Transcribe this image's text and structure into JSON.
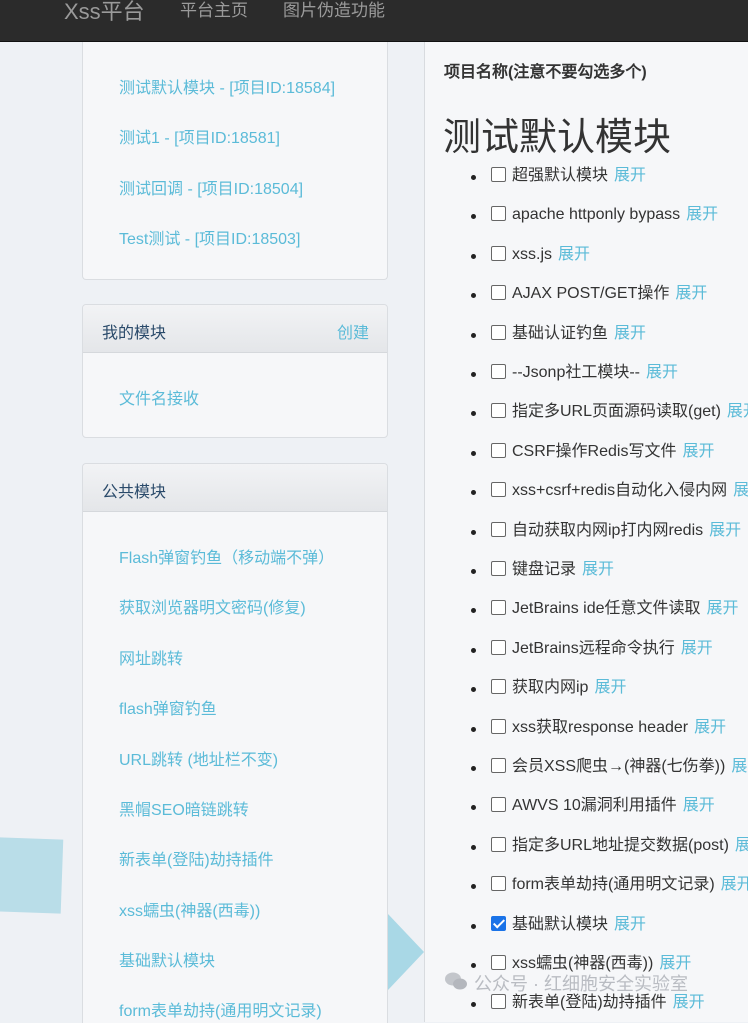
{
  "navbar": {
    "brand": "Xss平台",
    "links": [
      "平台主页",
      "图片伪造功能"
    ]
  },
  "projects": {
    "items": [
      "测试默认模块 - [项目ID:18584]",
      "测试1 - [项目ID:18581]",
      "测试回调 - [项目ID:18504]",
      "Test测试 - [项目ID:18503]"
    ]
  },
  "my_modules": {
    "title": "我的模块",
    "create": "创建",
    "items": [
      "文件名接收"
    ]
  },
  "public_modules": {
    "title": "公共模块",
    "items": [
      "Flash弹窗钓鱼（移动端不弹）",
      "获取浏览器明文密码(修复)",
      "网址跳转",
      "flash弹窗钓鱼",
      "URL跳转 (地址栏不变)",
      "黑帽SEO暗链跳转",
      "新表单(登陆)劫持插件",
      "xss蠕虫(神器(西毒))",
      "基础默认模块",
      "form表单劫持(通用明文记录)"
    ]
  },
  "project_form": {
    "label": "项目名称(注意不要勾选多个)",
    "heading": "测试默认模块",
    "expand_label": "展开",
    "modules": [
      {
        "name": "超强默认模块",
        "checked": false
      },
      {
        "name": "apache httponly bypass",
        "checked": false
      },
      {
        "name": "xss.js",
        "checked": false
      },
      {
        "name": "AJAX POST/GET操作",
        "checked": false
      },
      {
        "name": "基础认证钓鱼",
        "checked": false
      },
      {
        "name": "--Jsonp社工模块--",
        "checked": false
      },
      {
        "name": "指定多URL页面源码读取(get)",
        "checked": false
      },
      {
        "name": "CSRF操作Redis写文件",
        "checked": false
      },
      {
        "name": "xss+csrf+redis自动化入侵内网",
        "checked": false
      },
      {
        "name": "自动获取内网ip打内网redis",
        "checked": false
      },
      {
        "name": "键盘记录",
        "checked": false
      },
      {
        "name": "JetBrains ide任意文件读取",
        "checked": false
      },
      {
        "name": "JetBrains远程命令执行",
        "checked": false
      },
      {
        "name": "获取内网ip",
        "checked": false
      },
      {
        "name": "xss获取response header",
        "checked": false
      },
      {
        "name": "会员XSS爬虫→(神器(七伤拳))",
        "checked": false
      },
      {
        "name": "AWVS 10漏洞利用插件",
        "checked": false
      },
      {
        "name": "指定多URL地址提交数据(post)",
        "checked": false
      },
      {
        "name": "form表单劫持(通用明文记录)",
        "checked": false
      },
      {
        "name": "基础默认模块",
        "checked": true
      },
      {
        "name": "xss蠕虫(神器(西毒))",
        "checked": false
      },
      {
        "name": "新表单(登陆)劫持插件",
        "checked": false
      }
    ]
  },
  "watermark": "公众号 · 红细胞安全实验室",
  "colors": {
    "navbar_bg": "#2b2b2b",
    "link": "#5bbbd8",
    "checkbox_checked": "#1a73e8"
  }
}
